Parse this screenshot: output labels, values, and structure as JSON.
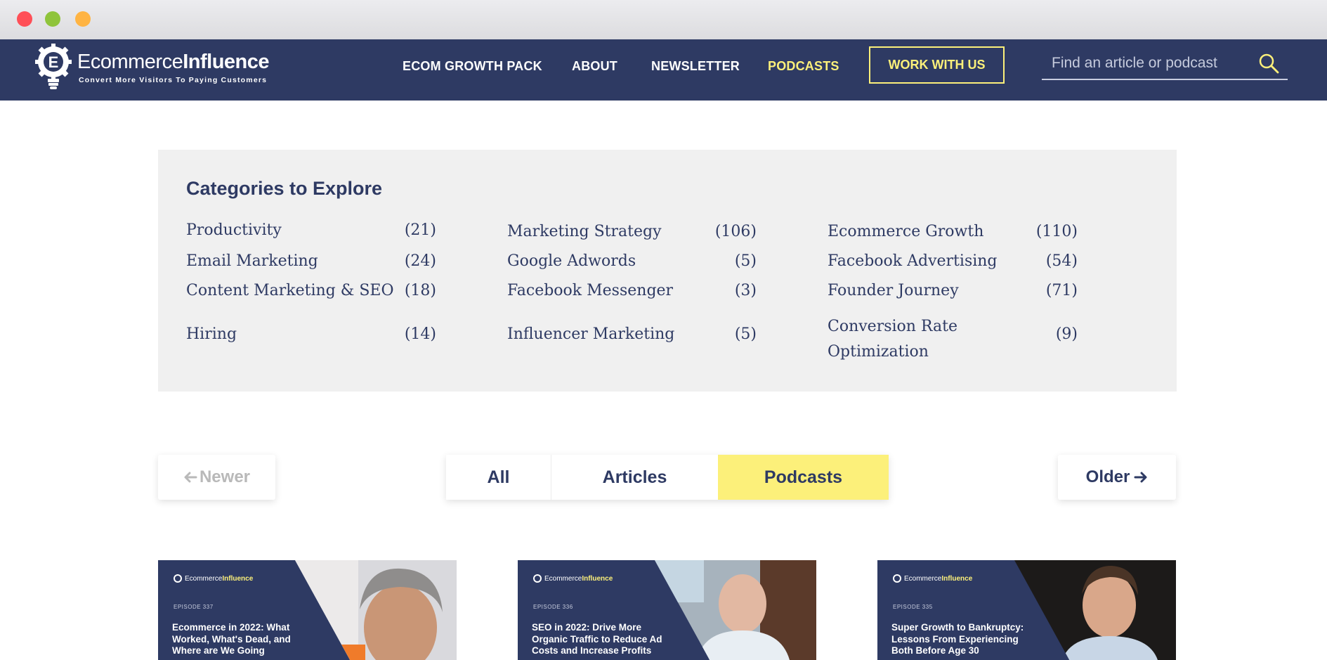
{
  "brand": {
    "name_regular": "Ecommerce",
    "name_bold": "Influence",
    "tagline": "Convert More Visitors To Paying Customers"
  },
  "nav": {
    "items": [
      {
        "label": "ECOM GROWTH PACK"
      },
      {
        "label": "ABOUT"
      },
      {
        "label": "NEWSLETTER"
      },
      {
        "label": "PODCASTS",
        "active": true
      }
    ],
    "cta_label": "WORK WITH US",
    "search_placeholder": "Find an article or podcast"
  },
  "categories": {
    "title": "Categories to Explore",
    "columns": [
      [
        {
          "name": "Productivity",
          "count": "(21)"
        },
        {
          "name": "Email Marketing",
          "count": "(24)"
        },
        {
          "name": "Content Marketing & SEO",
          "count": "(18)"
        },
        {
          "name": "Hiring",
          "count": "(14)"
        }
      ],
      [
        {
          "name": "Marketing Strategy",
          "count": "(106)"
        },
        {
          "name": "Google Adwords",
          "count": "(5)"
        },
        {
          "name": "Facebook Messenger",
          "count": "(3)"
        },
        {
          "name": "Influencer Marketing",
          "count": "(5)"
        }
      ],
      [
        {
          "name": "Ecommerce Growth",
          "count": "(110)"
        },
        {
          "name": "Facebook Advertising",
          "count": "(54)"
        },
        {
          "name": "Founder Journey",
          "count": "(71)"
        },
        {
          "name": "Conversion Rate Optimization",
          "count": "(9)"
        }
      ]
    ]
  },
  "pager": {
    "newer_label": "Newer",
    "older_label": "Older"
  },
  "filters": {
    "all": "All",
    "articles": "Articles",
    "podcasts": "Podcasts",
    "selected": "Podcasts"
  },
  "cards": [
    {
      "brand": "Ecommerce",
      "brand_bold": "Influence",
      "episode": "EPISODE 337",
      "title": "Ecommerce in 2022: What Worked, What's Dead, and Where are We Going"
    },
    {
      "brand": "Ecommerce",
      "brand_bold": "Influence",
      "episode": "EPISODE 336",
      "title": "SEO in 2022: Drive More Organic Traffic to Reduce Ad Costs and Increase Profits"
    },
    {
      "brand": "Ecommerce",
      "brand_bold": "Influence",
      "episode": "EPISODE 335",
      "title": "Super Growth to Bankruptcy: Lessons From Experiencing Both Before Age 30"
    }
  ],
  "colors": {
    "navy": "#2e3a63",
    "accent_yellow": "#fcf07a",
    "panel_gray": "#f0f0f0"
  },
  "icons": [
    "lightbulb-gear-logo-icon",
    "search-icon",
    "arrow-left-icon",
    "arrow-right-icon"
  ]
}
